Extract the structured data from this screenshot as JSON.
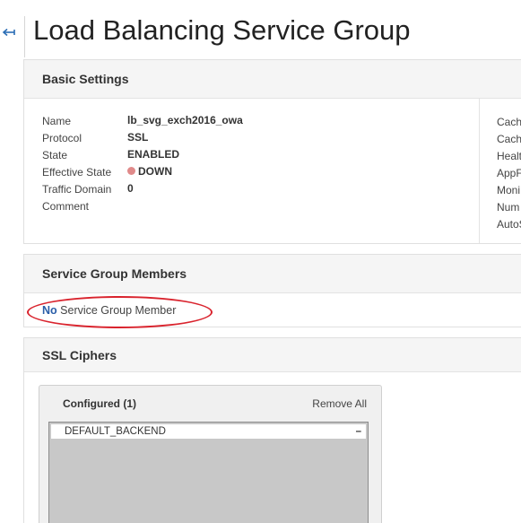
{
  "header": {
    "back_icon": "back-arrow-icon",
    "title": "Load Balancing Service Group"
  },
  "basic_settings": {
    "title": "Basic Settings",
    "labels": [
      "Name",
      "Protocol",
      "State",
      "Effective State",
      "Traffic Domain",
      "Comment"
    ],
    "values": {
      "name": "lb_svg_exch2016_owa",
      "protocol": "SSL",
      "state": "ENABLED",
      "effective_state": "DOWN",
      "traffic_domain": "0"
    },
    "status_color": "#e08a8a",
    "right_labels": [
      "Cach",
      "Cach",
      "Healt",
      "AppF",
      "Moni",
      "Num",
      "AutoS"
    ]
  },
  "service_group_members": {
    "title": "Service Group Members",
    "no": "No",
    "text": "Service Group Member",
    "highlight_color": "#d9232d"
  },
  "ssl_ciphers": {
    "title": "SSL Ciphers",
    "configured_label": "Configured (1)",
    "remove_all": "Remove All",
    "items": [
      {
        "label": "DEFAULT_BACKEND",
        "remove_icon": "minus-icon",
        "remove_glyph": "–"
      }
    ]
  }
}
